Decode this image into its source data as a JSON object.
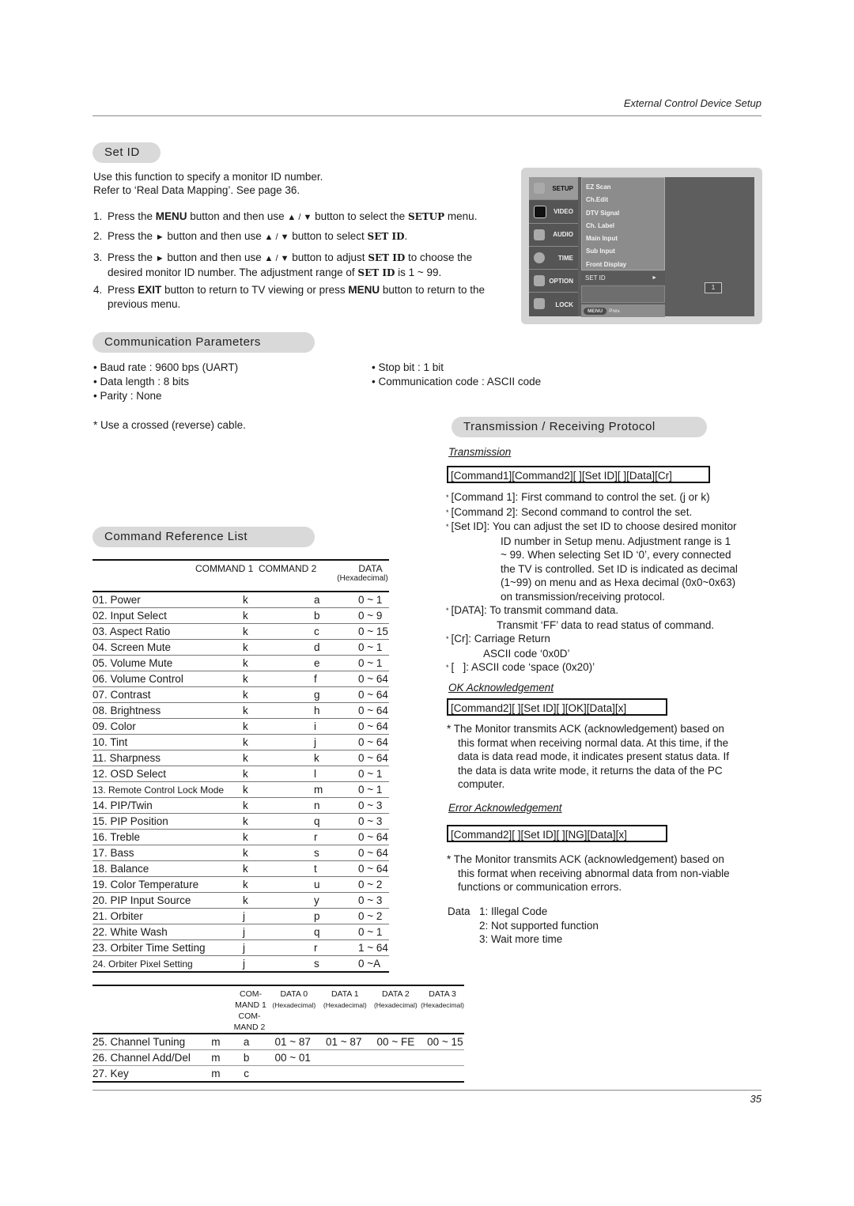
{
  "header": {
    "title": "External Control Device Setup"
  },
  "set_id": {
    "heading": "Set ID",
    "intro": [
      "Use this function to specify a monitor ID number.",
      "Refer to ‘Real Data Mapping’. See page 36."
    ],
    "steps": [
      {
        "num": "1.",
        "p1": "Press the ",
        "b1": "MENU",
        "p2": " button and then use ",
        "arrows": "▲ / ▼",
        "p3": " button to select the ",
        "b2": "SETUP",
        "p4": " menu."
      },
      {
        "num": "2.",
        "p1": "Press the ",
        "tri": "►",
        "p2": " button and then use ",
        "arrows": "▲ / ▼",
        "p3": " button to select ",
        "b2": "SET ID",
        "p4": "."
      },
      {
        "num": "3.",
        "p1": "Press the ",
        "tri": "►",
        "p2": " button and then use ",
        "arrows": "▲ / ▼",
        "p3": " button to adjust ",
        "b2": "SET ID",
        "p4": " to choose the",
        "line2a": "desired monitor ID number. The adjustment range of ",
        "line2b": "SET ID",
        "line2c": " is 1 ~ 99."
      },
      {
        "num": "4.",
        "p1": "Press ",
        "b1": "EXIT",
        "p2": " button to return to TV viewing or press ",
        "b2": "MENU",
        "p3": " button to return to the",
        "line2": "previous menu."
      }
    ]
  },
  "osd": {
    "tabs": [
      {
        "label": "SETUP",
        "icon": "satellite-dish-icon",
        "active": true
      },
      {
        "label": "VIDEO",
        "icon": "tv-icon"
      },
      {
        "label": "AUDIO",
        "icon": "speaker-icon"
      },
      {
        "label": "TIME",
        "icon": "clock-icon"
      },
      {
        "label": "OPTION",
        "icon": "tools-icon"
      },
      {
        "label": "LOCK",
        "icon": "padlock-icon"
      }
    ],
    "items": [
      "EZ Scan",
      "Ch.Edit",
      "DTV Signal",
      "Ch. Label",
      "Main Input",
      "Sub Input",
      "Front Display"
    ],
    "selected": "SET ID",
    "selected_arrow": "►",
    "value": "1",
    "menu_button": "MENU",
    "prev_label": "Prev."
  },
  "comm_params": {
    "heading": "Communication Parameters",
    "left": [
      "Baud rate : 9600 bps (UART)",
      "Data length : 8 bits",
      "Parity : None"
    ],
    "right": [
      "Stop bit : 1 bit",
      "Communication code : ASCII code"
    ],
    "cable_note": "* Use a crossed (reverse) cable."
  },
  "protocol": {
    "heading": "Transmission / Receiving  Protocol",
    "transmission_label": "Transmission",
    "transmission_format": "[Command1][Command2][  ][Set ID][  ][Data][Cr]",
    "notes": [
      {
        "key": "[Command 1]:",
        "lines": [
          "First command to control the set. (j or k)"
        ]
      },
      {
        "key": "[Command 2]:",
        "lines": [
          "Second command to control the set."
        ]
      },
      {
        "key": "[Set ID]:",
        "lines": [
          "You can adjust the set ID to choose desired monitor",
          "ID number in Setup menu. Adjustment range is 1",
          "~ 99. When selecting Set ID ‘0’, every connected",
          "the TV is controlled. Set ID is indicated as decimal",
          "(1~99) on menu and as Hexa decimal (0x0~0x63)",
          "on transmission/receiving protocol."
        ]
      },
      {
        "key": "[DATA]:",
        "lines": [
          "To transmit command data.",
          "Transmit ‘FF’ data to read status of command."
        ]
      },
      {
        "key": "[Cr]:",
        "lines": [
          "Carriage Return",
          "ASCII code ‘0x0D’"
        ]
      },
      {
        "key": "[   ]:",
        "lines": [
          "ASCII code ‘space (0x20)’"
        ]
      }
    ],
    "ok_label": "OK Acknowledgement",
    "ok_format": "[Command2][  ][Set ID][  ][OK][Data][x]",
    "ok_note": [
      "* The Monitor transmits ACK (acknowledgement) based on",
      "this format when receiving normal data. At this time, if the",
      "data is data read mode, it indicates present status data. If",
      "the data is data write mode, it returns the data of the PC",
      "computer."
    ],
    "err_label": "Error Acknowledgement",
    "err_format": "[Command2][  ][Set ID][  ][NG][Data][x]",
    "err_note": [
      "* The Monitor transmits ACK (acknowledgement) based on",
      "this format when receiving abnormal data from non-viable",
      "functions or communication errors."
    ],
    "data_label": "Data",
    "data_codes": [
      "1: Illegal Code",
      "2: Not supported function",
      "3: Wait more time"
    ]
  },
  "cmd_list": {
    "heading": "Command Reference List",
    "headers": {
      "cmd1": "COMMAND 1",
      "cmd2": "COMMAND 2",
      "data": "DATA",
      "data_sub": "(Hexadecimal)"
    },
    "rows": [
      [
        "01. Power",
        "k",
        "a",
        "0 ~ 1"
      ],
      [
        "02. Input Select",
        "k",
        "b",
        "0 ~ 9"
      ],
      [
        "03. Aspect Ratio",
        "k",
        "c",
        "0 ~ 15"
      ],
      [
        "04. Screen Mute",
        "k",
        "d",
        "0 ~ 1"
      ],
      [
        "05. Volume Mute",
        "k",
        "e",
        "0 ~ 1"
      ],
      [
        "06. Volume Control",
        "k",
        "f",
        "0 ~ 64"
      ],
      [
        "07. Contrast",
        "k",
        "g",
        "0 ~ 64"
      ],
      [
        "08. Brightness",
        "k",
        "h",
        "0 ~ 64"
      ],
      [
        "09. Color",
        "k",
        "i",
        "0 ~ 64"
      ],
      [
        "10. Tint",
        "k",
        "j",
        "0 ~ 64"
      ],
      [
        "11. Sharpness",
        "k",
        "k",
        "0 ~ 64"
      ],
      [
        "12. OSD Select",
        "k",
        "l",
        "0 ~ 1"
      ],
      [
        "13. Remote Control Lock Mode",
        "k",
        "m",
        "0 ~ 1"
      ],
      [
        "14. PIP/Twin",
        "k",
        "n",
        "0 ~ 3"
      ],
      [
        "15. PIP Position",
        "k",
        "q",
        "0 ~ 3"
      ],
      [
        "16. Treble",
        "k",
        "r",
        "0 ~ 64"
      ],
      [
        "17. Bass",
        "k",
        "s",
        "0 ~ 64"
      ],
      [
        "18. Balance",
        "k",
        "t",
        "0 ~ 64"
      ],
      [
        "19. Color Temperature",
        "k",
        "u",
        "0 ~ 2"
      ],
      [
        "20. PIP Input Source",
        "k",
        "y",
        "0 ~ 3"
      ],
      [
        "21. Orbiter",
        "j",
        "p",
        "0 ~ 2"
      ],
      [
        "22. White Wash",
        "j",
        "q",
        "0 ~ 1"
      ],
      [
        "23. Orbiter Time Setting",
        "j",
        "r",
        "1 ~ 64"
      ],
      [
        "24. Orbiter Pixel Setting",
        "j",
        "s",
        "0 ~A"
      ]
    ],
    "headers2": {
      "cmd1a": "COM-",
      "cmd1b": "MAND 1",
      "cmd2a": "COM-",
      "cmd2b": "MAND 2",
      "d0": "DATA 0",
      "d1": "DATA 1",
      "d2": "DATA 2",
      "d3": "DATA 3",
      "hex": "(Hexadecimal)"
    },
    "rows2": [
      [
        "25. Channel Tuning",
        "m",
        "a",
        "01 ~ 87",
        "01 ~ 87",
        "00 ~ FE",
        "00 ~ 15"
      ],
      [
        "26. Channel Add/Del",
        "m",
        "b",
        "00 ~ 01",
        "",
        "",
        ""
      ],
      [
        "27. Key",
        "m",
        "c",
        "",
        "",
        "",
        ""
      ]
    ]
  },
  "footer": {
    "page_number": "35"
  }
}
